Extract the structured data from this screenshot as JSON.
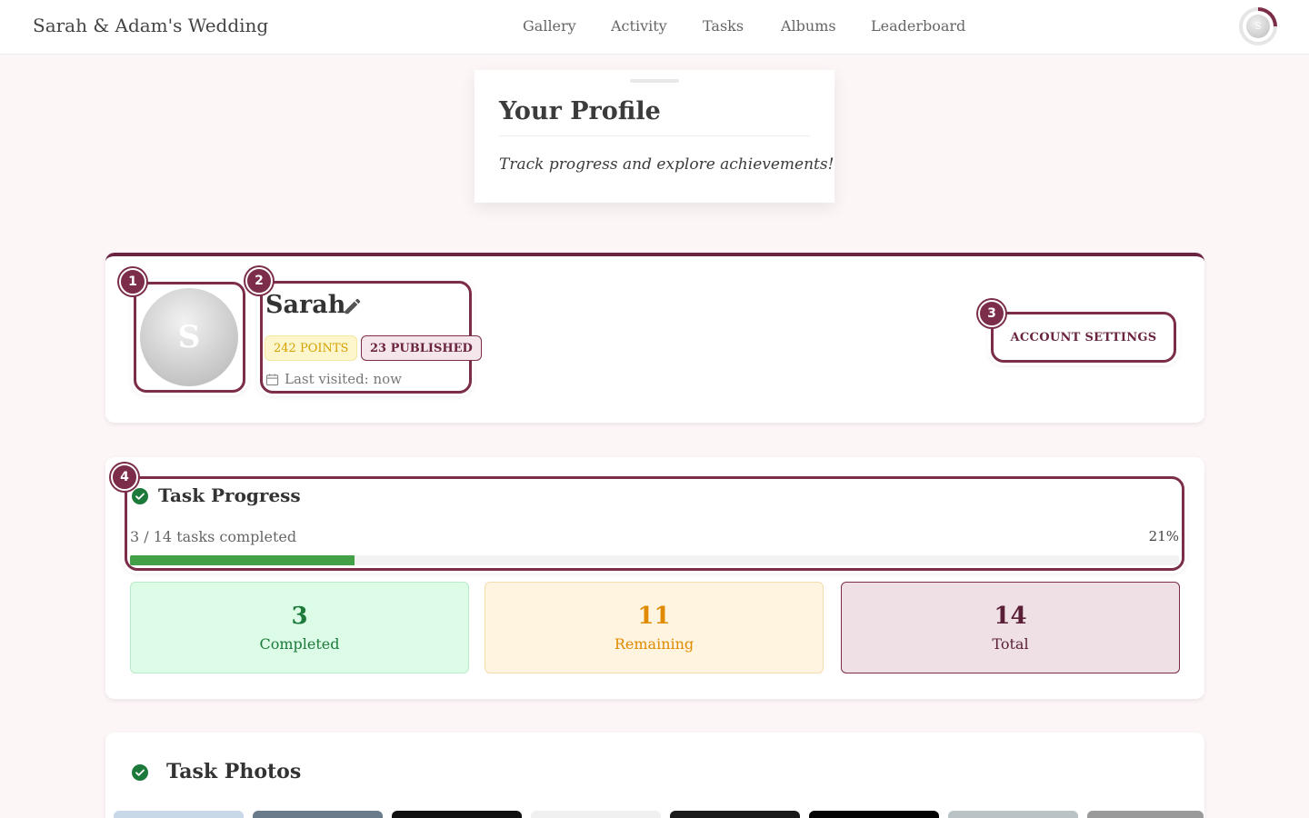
{
  "header": {
    "brand": "Sarah & Adam's Wedding",
    "nav": [
      {
        "label": "Gallery"
      },
      {
        "label": "Activity"
      },
      {
        "label": "Tasks"
      },
      {
        "label": "Albums"
      },
      {
        "label": "Leaderboard"
      }
    ],
    "avatar_initial": "S"
  },
  "profile_heading": {
    "title": "Your Profile",
    "subtitle": "Track progress and explore achievements!"
  },
  "profile": {
    "avatar_initial": "S",
    "name": "Sarah",
    "points_badge": "242 POINTS",
    "published_badge": "23 PUBLISHED",
    "last_visited": "Last visited: now",
    "settings_button": "ACCOUNT SETTINGS",
    "markers": [
      "1",
      "2",
      "3"
    ]
  },
  "task_progress": {
    "marker": "4",
    "title": "Task Progress",
    "count_text": "3 / 14 tasks completed",
    "percent_text": "21%",
    "progress_fraction": 0.214,
    "stats": [
      {
        "value": "3",
        "label": "Completed"
      },
      {
        "value": "11",
        "label": "Remaining"
      },
      {
        "value": "14",
        "label": "Total"
      }
    ]
  },
  "task_photos": {
    "title": "Task Photos",
    "thumbnail_colors": [
      "#c8d8e8",
      "#6a7b8c",
      "#111111",
      "#f0f0f0",
      "#1a1a1a",
      "#050505",
      "#b9c3c6",
      "#9a9a9a"
    ]
  },
  "colors": {
    "accent": "#7b2d4a",
    "progress_fill": "#43a047"
  }
}
